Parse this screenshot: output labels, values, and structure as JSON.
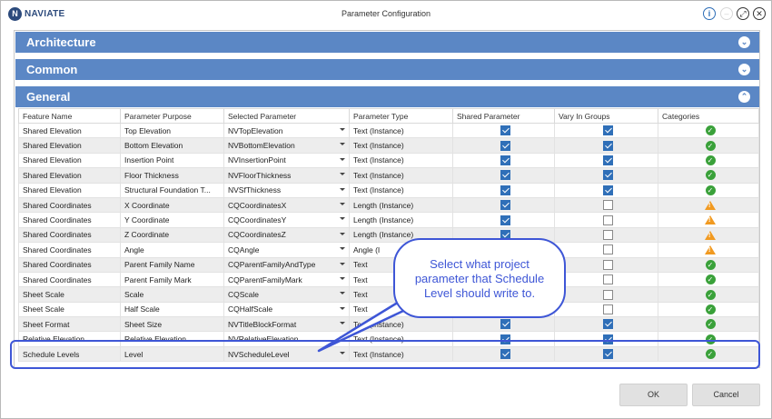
{
  "app": {
    "logo_text": "NAVIATE",
    "logo_letter": "N",
    "window_title": "Parameter Configuration"
  },
  "titlebar_icons": [
    "info-icon",
    "minimize-icon",
    "restore-icon",
    "close-icon"
  ],
  "sections": [
    {
      "label": "Architecture",
      "state": "collapsed"
    },
    {
      "label": "Common",
      "state": "collapsed"
    },
    {
      "label": "General",
      "state": "expanded"
    }
  ],
  "table": {
    "columns": [
      "Feature Name",
      "Parameter Purpose",
      "Selected Parameter",
      "Parameter Type",
      "Shared Parameter",
      "Vary In Groups",
      "Categories"
    ],
    "rows": [
      {
        "feature": "Shared Elevation",
        "purpose": "Top Elevation",
        "param": "NVTopElevation",
        "type": "Text (Instance)",
        "shared": true,
        "vary": true,
        "cat": "ok"
      },
      {
        "feature": "Shared Elevation",
        "purpose": "Bottom Elevation",
        "param": "NVBottomElevation",
        "type": "Text (Instance)",
        "shared": true,
        "vary": true,
        "cat": "ok"
      },
      {
        "feature": "Shared Elevation",
        "purpose": "Insertion Point",
        "param": "NVInsertionPoint",
        "type": "Text (Instance)",
        "shared": true,
        "vary": true,
        "cat": "ok"
      },
      {
        "feature": "Shared Elevation",
        "purpose": "Floor Thickness",
        "param": "NVFloorThickness",
        "type": "Text (Instance)",
        "shared": true,
        "vary": true,
        "cat": "ok"
      },
      {
        "feature": "Shared Elevation",
        "purpose": "Structural Foundation T...",
        "param": "NVSfThickness",
        "type": "Text (Instance)",
        "shared": true,
        "vary": true,
        "cat": "ok"
      },
      {
        "feature": "Shared Coordinates",
        "purpose": "X Coordinate",
        "param": "CQCoordinatesX",
        "type": "Length (Instance)",
        "shared": true,
        "vary": false,
        "cat": "warn"
      },
      {
        "feature": "Shared Coordinates",
        "purpose": "Y Coordinate",
        "param": "CQCoordinatesY",
        "type": "Length (Instance)",
        "shared": true,
        "vary": false,
        "cat": "warn"
      },
      {
        "feature": "Shared Coordinates",
        "purpose": "Z Coordinate",
        "param": "CQCoordinatesZ",
        "type": "Length (Instance)",
        "shared": true,
        "vary": false,
        "cat": "warn"
      },
      {
        "feature": "Shared Coordinates",
        "purpose": "Angle",
        "param": "CQAngle",
        "type": "Angle (I",
        "shared": true,
        "vary": false,
        "cat": "warn"
      },
      {
        "feature": "Shared Coordinates",
        "purpose": "Parent Family Name",
        "param": "CQParentFamilyAndType",
        "type": "Text",
        "shared": true,
        "vary": false,
        "cat": "ok"
      },
      {
        "feature": "Shared Coordinates",
        "purpose": "Parent Family Mark",
        "param": "CQParentFamilyMark",
        "type": "Text",
        "shared": true,
        "vary": false,
        "cat": "ok"
      },
      {
        "feature": "Sheet Scale",
        "purpose": "Scale",
        "param": "CQScale",
        "type": "Text",
        "shared": true,
        "vary": false,
        "cat": "ok"
      },
      {
        "feature": "Sheet Scale",
        "purpose": "Half Scale",
        "param": "CQHalfScale",
        "type": "Text",
        "shared": true,
        "vary": false,
        "cat": "ok"
      },
      {
        "feature": "Sheet Format",
        "purpose": "Sheet Size",
        "param": "NVTitleBlockFormat",
        "type": "Text (Instance)",
        "shared": true,
        "vary": true,
        "cat": "ok"
      },
      {
        "feature": "Relative Elevation",
        "purpose": "Relative Elevation",
        "param": "NVRelativeElevation",
        "type": "Text (Instance)",
        "shared": true,
        "vary": true,
        "cat": "ok"
      },
      {
        "feature": "Schedule Levels",
        "purpose": "Level",
        "param": "NVScheduleLevel",
        "type": "Text (Instance)",
        "shared": true,
        "vary": true,
        "cat": "ok"
      }
    ]
  },
  "callout": {
    "lines": [
      "Select what project",
      "parameter that Schedule",
      "Level should write to."
    ],
    "color": "#3e56d6"
  },
  "buttons": {
    "ok": "OK",
    "cancel": "Cancel"
  },
  "colors": {
    "section_header": "#5b87c5",
    "checkbox_on": "#2f6fb8",
    "ok_green": "#3aa13a",
    "warn_orange": "#f19a21",
    "annotation_blue": "#3e56d6"
  }
}
